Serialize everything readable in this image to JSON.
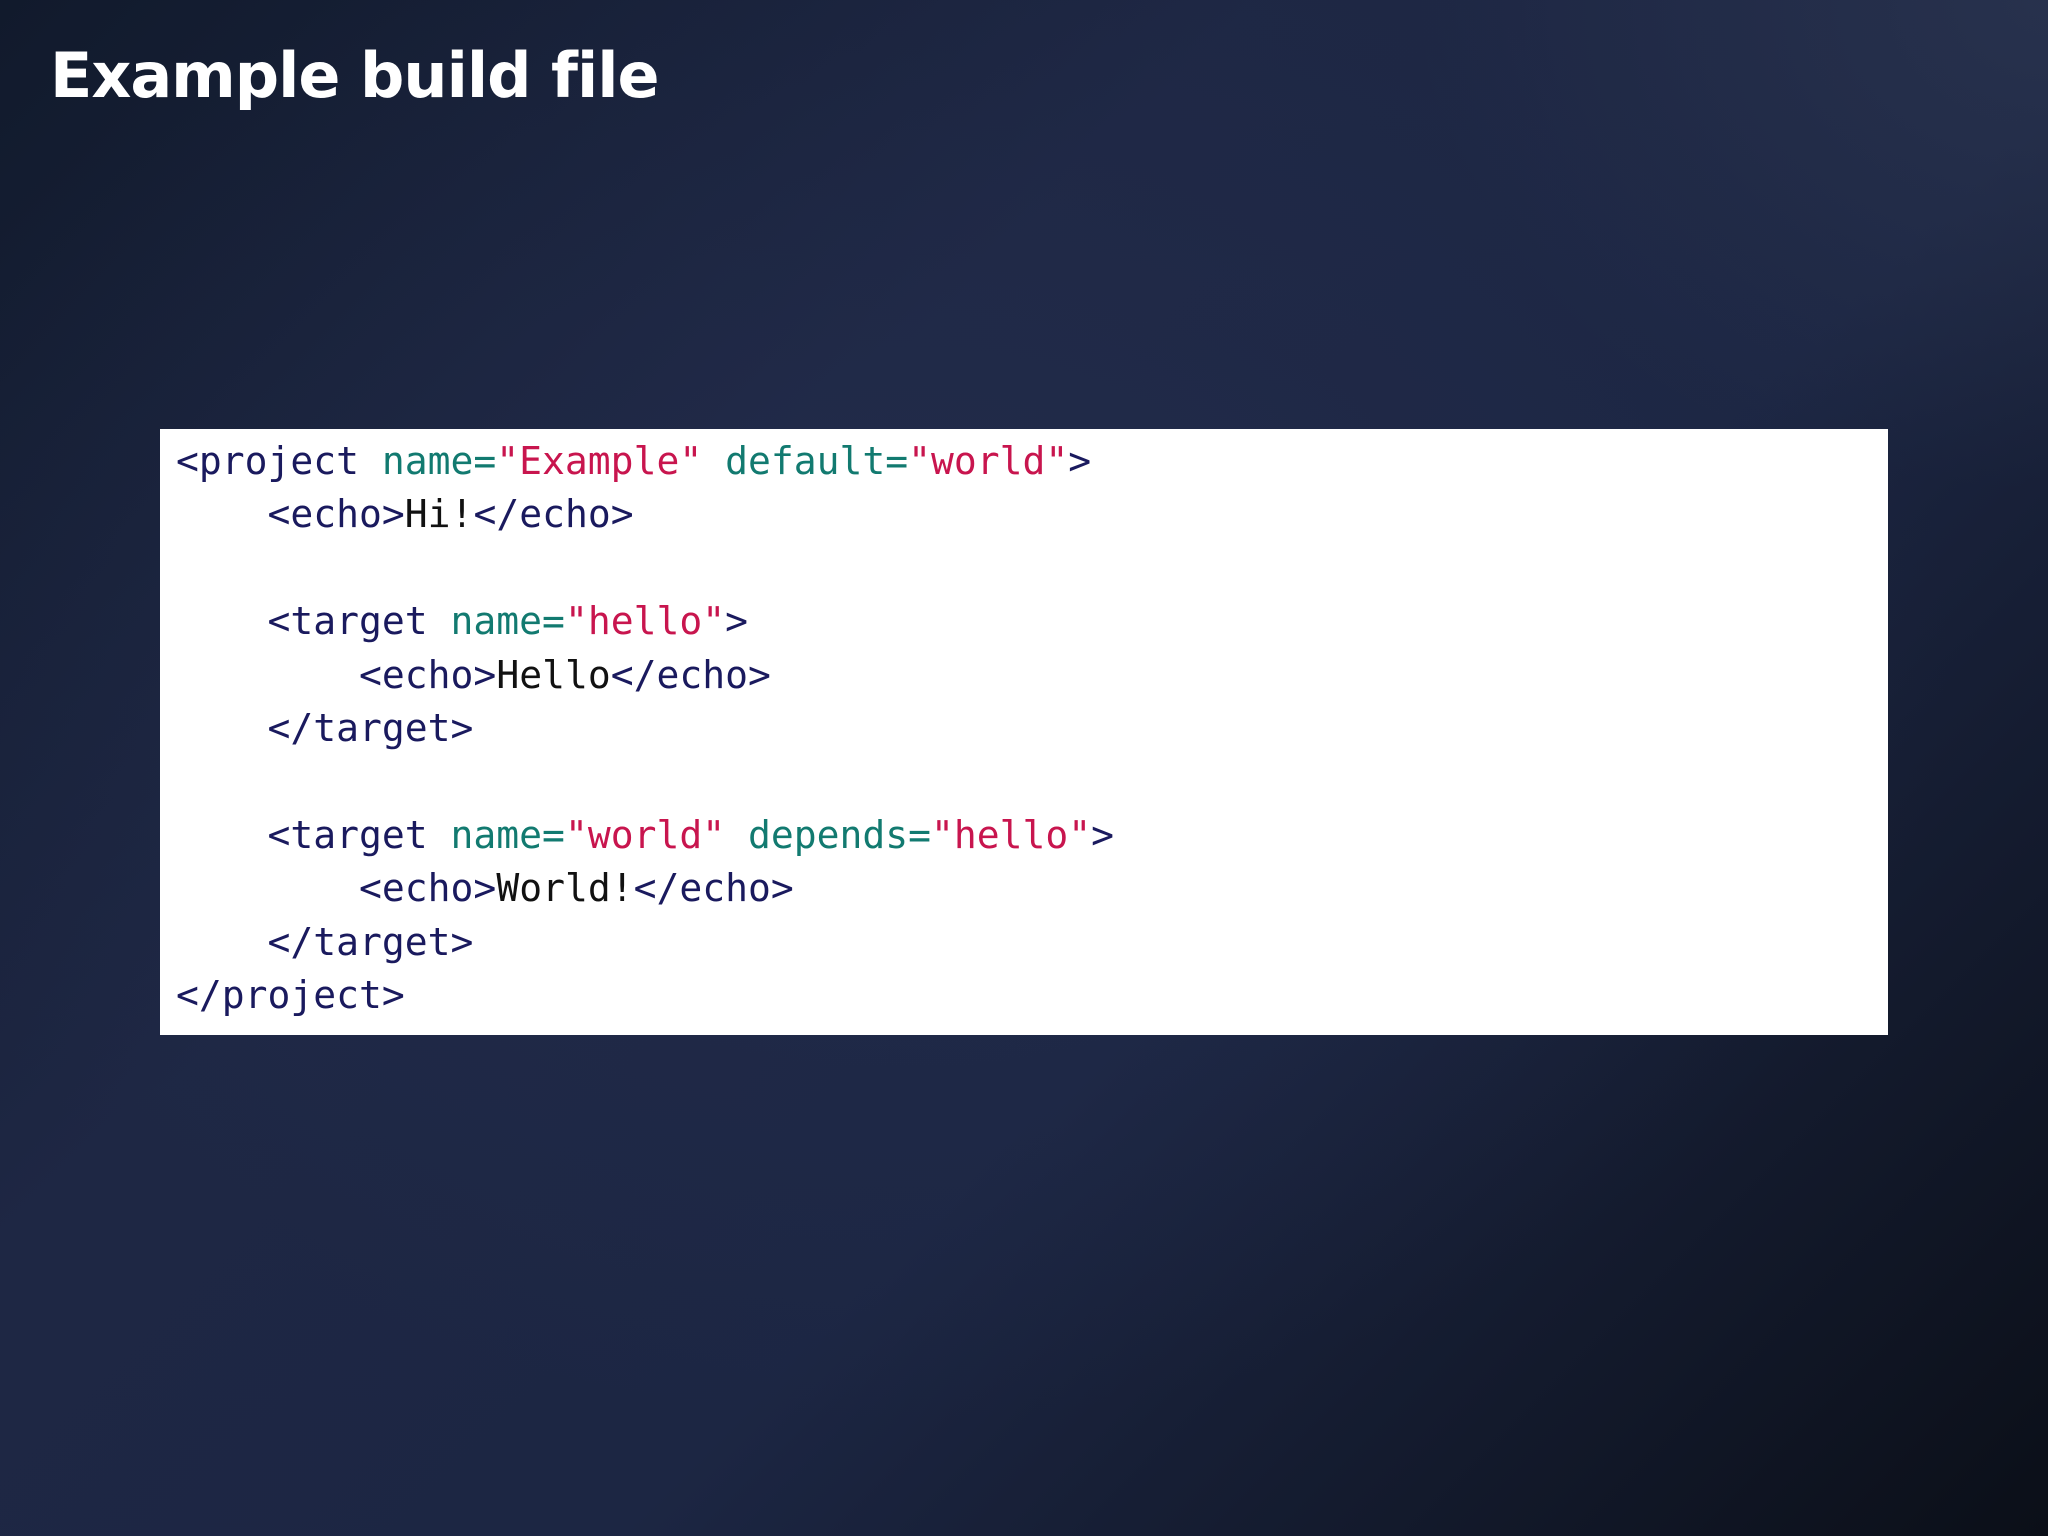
{
  "slide": {
    "title": "Example build file"
  },
  "code": {
    "language": "xml",
    "colors": {
      "tag": "#1a1a5e",
      "attribute": "#127a70",
      "string": "#c8154e",
      "text": "#111111",
      "panel_background": "#ffffff"
    },
    "lines": [
      [
        {
          "t": "tag",
          "v": "<project "
        },
        {
          "t": "attr",
          "v": "name="
        },
        {
          "t": "str",
          "v": "\"Example\""
        },
        {
          "t": "text",
          "v": " "
        },
        {
          "t": "attr",
          "v": "default="
        },
        {
          "t": "str",
          "v": "\"world\""
        },
        {
          "t": "tag",
          "v": ">"
        }
      ],
      [
        {
          "t": "text",
          "v": "    "
        },
        {
          "t": "tag",
          "v": "<echo>"
        },
        {
          "t": "text",
          "v": "Hi!"
        },
        {
          "t": "tag",
          "v": "</echo>"
        }
      ],
      [],
      [
        {
          "t": "text",
          "v": "    "
        },
        {
          "t": "tag",
          "v": "<target "
        },
        {
          "t": "attr",
          "v": "name="
        },
        {
          "t": "str",
          "v": "\"hello\""
        },
        {
          "t": "tag",
          "v": ">"
        }
      ],
      [
        {
          "t": "text",
          "v": "        "
        },
        {
          "t": "tag",
          "v": "<echo>"
        },
        {
          "t": "text",
          "v": "Hello"
        },
        {
          "t": "tag",
          "v": "</echo>"
        }
      ],
      [
        {
          "t": "text",
          "v": "    "
        },
        {
          "t": "tag",
          "v": "</target>"
        }
      ],
      [],
      [
        {
          "t": "text",
          "v": "    "
        },
        {
          "t": "tag",
          "v": "<target "
        },
        {
          "t": "attr",
          "v": "name="
        },
        {
          "t": "str",
          "v": "\"world\""
        },
        {
          "t": "text",
          "v": " "
        },
        {
          "t": "attr",
          "v": "depends="
        },
        {
          "t": "str",
          "v": "\"hello\""
        },
        {
          "t": "tag",
          "v": ">"
        }
      ],
      [
        {
          "t": "text",
          "v": "        "
        },
        {
          "t": "tag",
          "v": "<echo>"
        },
        {
          "t": "text",
          "v": "World!"
        },
        {
          "t": "tag",
          "v": "</echo>"
        }
      ],
      [
        {
          "t": "text",
          "v": "    "
        },
        {
          "t": "tag",
          "v": "</target>"
        }
      ],
      [
        {
          "t": "tag",
          "v": "</project>"
        }
      ]
    ]
  }
}
